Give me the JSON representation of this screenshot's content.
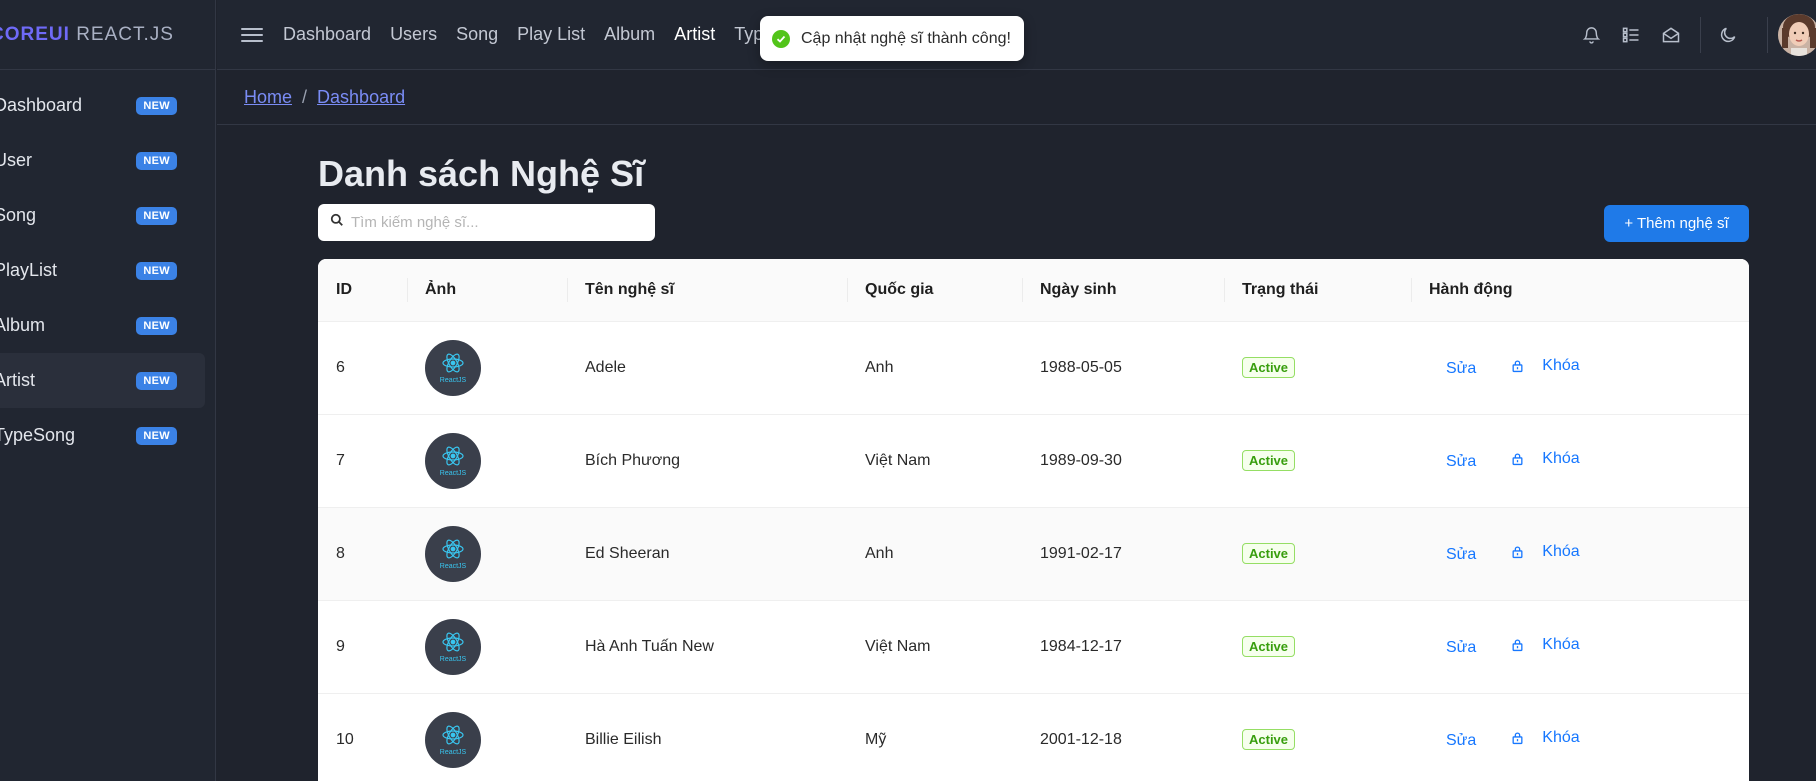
{
  "brand": {
    "core": "COREUI",
    "rest": "REACT.JS"
  },
  "sidebar": {
    "items": [
      {
        "label": "Dashboard",
        "badge": "NEW"
      },
      {
        "label": "User",
        "badge": "NEW"
      },
      {
        "label": "Song",
        "badge": "NEW"
      },
      {
        "label": "PlayList",
        "badge": "NEW"
      },
      {
        "label": "Album",
        "badge": "NEW"
      },
      {
        "label": "Artist",
        "badge": "NEW",
        "active": true
      },
      {
        "label": "TypeSong",
        "badge": "NEW"
      }
    ]
  },
  "header": {
    "nav": [
      "Dashboard",
      "Users",
      "Song",
      "Play List",
      "Album",
      "Artist",
      "Typy"
    ],
    "active_nav": "Artist",
    "icons": [
      "bell-icon",
      "list-icon",
      "envelope-open-icon",
      "moon-icon"
    ]
  },
  "breadcrumb": {
    "home": "Home",
    "current": "Dashboard"
  },
  "toast": {
    "message": "Cập nhật nghệ sĩ thành công!"
  },
  "main": {
    "title": "Danh sách Nghệ Sĩ",
    "search_placeholder": "Tìm kiếm nghệ sĩ...",
    "add_button": "+ Thêm nghệ sĩ"
  },
  "table": {
    "columns": [
      "ID",
      "Ảnh",
      "Tên nghệ sĩ",
      "Quốc gia",
      "Ngày sinh",
      "Trạng thái",
      "Hành động"
    ],
    "rows": [
      {
        "id": "6",
        "image_text": "ReactJS",
        "name": "Adele",
        "country": "Anh",
        "birthdate": "1988-05-05",
        "status": "Active",
        "edit": "Sửa",
        "lock": "Khóa"
      },
      {
        "id": "7",
        "image_text": "ReactJS",
        "name": "Bích Phương",
        "country": "Việt Nam",
        "birthdate": "1989-09-30",
        "status": "Active",
        "edit": "Sửa",
        "lock": "Khóa"
      },
      {
        "id": "8",
        "image_text": "ReactJS",
        "name": "Ed Sheeran",
        "country": "Anh",
        "birthdate": "1991-02-17",
        "status": "Active",
        "edit": "Sửa",
        "lock": "Khóa"
      },
      {
        "id": "9",
        "image_text": "ReactJS",
        "name": "Hà Anh Tuấn New",
        "country": "Việt Nam",
        "birthdate": "1984-12-17",
        "status": "Active",
        "edit": "Sửa",
        "lock": "Khóa"
      },
      {
        "id": "10",
        "image_text": "ReactJS",
        "name": "Billie Eilish",
        "country": "Mỹ",
        "birthdate": "2001-12-18",
        "status": "Active",
        "edit": "Sửa",
        "lock": "Khóa"
      }
    ]
  },
  "colors": {
    "background": "#1f232d",
    "sidebar": "#212631",
    "accent": "#1f7ae8",
    "brand": "#6f6af8",
    "badge": "#3b82e6",
    "success": "#52c41a"
  }
}
